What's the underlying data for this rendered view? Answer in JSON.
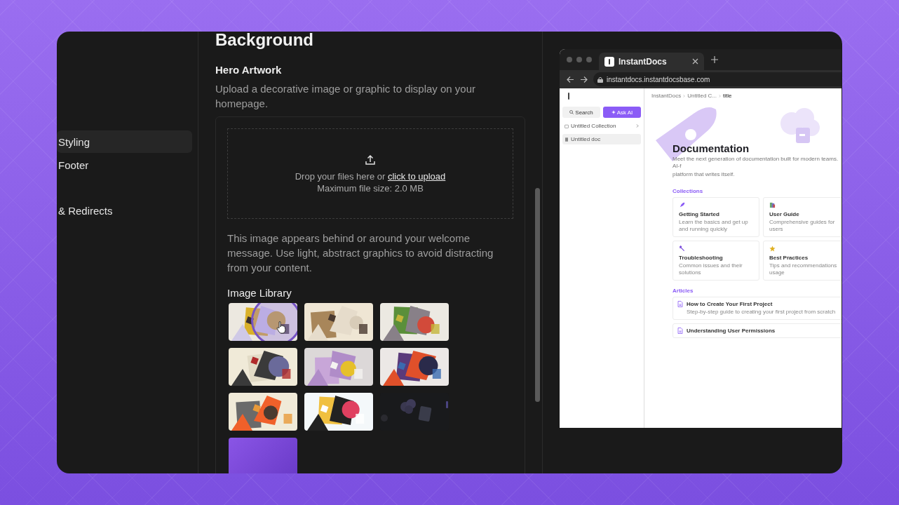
{
  "sidebar": {
    "items": [
      {
        "label": "Styling",
        "selected": true
      },
      {
        "label": "Footer",
        "selected": false
      },
      {
        "label": "& Redirects",
        "selected": false
      }
    ]
  },
  "section": {
    "title": "Background",
    "field_label": "Hero Artwork",
    "description": "Upload a decorative image or graphic to display on your homepage.",
    "upload": {
      "prompt": "Drop your files here or ",
      "link": "click to upload",
      "limit": "Maximum file size: 2.0 MB"
    },
    "help": "This image appears behind or around your welcome message. Use light, abstract graphics to avoid distracting from your content.",
    "library_title": "Image Library",
    "library": [
      {
        "kind": "picture"
      },
      {
        "kind": "picture"
      },
      {
        "kind": "picture"
      },
      {
        "kind": "picture"
      },
      {
        "kind": "picture"
      },
      {
        "kind": "picture"
      },
      {
        "kind": "picture"
      },
      {
        "kind": "picture"
      },
      {
        "kind": "faded"
      },
      {
        "kind": "gradient"
      }
    ]
  },
  "preview": {
    "tab_title": "InstantDocs",
    "url": "instantdocs.instantdocsbase.com",
    "page": {
      "search": "Search",
      "ask_ai": "Ask AI",
      "nav": [
        {
          "label": "Untitled Collection",
          "kind": "collection",
          "selected": false
        },
        {
          "label": "Untitled doc",
          "kind": "doc",
          "selected": true
        }
      ],
      "breadcrumb": [
        "InstantDocs",
        "Untitled C...",
        "title"
      ],
      "title": "Documentation",
      "description_lines": [
        "Meet the next generation of documentation built for modern teams. AI-f",
        "platform that writes itself."
      ],
      "collections_title": "Collections",
      "collections": [
        {
          "kind": "rocket",
          "title": "Getting Started",
          "description": "Learn the basics and get up and running quickly"
        },
        {
          "kind": "books",
          "title": "User Guide",
          "description": "Comprehensive guides for users"
        },
        {
          "kind": "wrench",
          "title": "Troubleshooting",
          "description": "Common issues and their solutions"
        },
        {
          "kind": "star",
          "title": "Best Practices",
          "description": "Tips and recommendations usage"
        }
      ],
      "articles_title": "Articles",
      "articles": [
        {
          "title": "How to Create Your First Project",
          "description": "Step-by-step guide to creating your first project from scratch"
        },
        {
          "title": "Understanding User Permissions"
        }
      ]
    }
  }
}
